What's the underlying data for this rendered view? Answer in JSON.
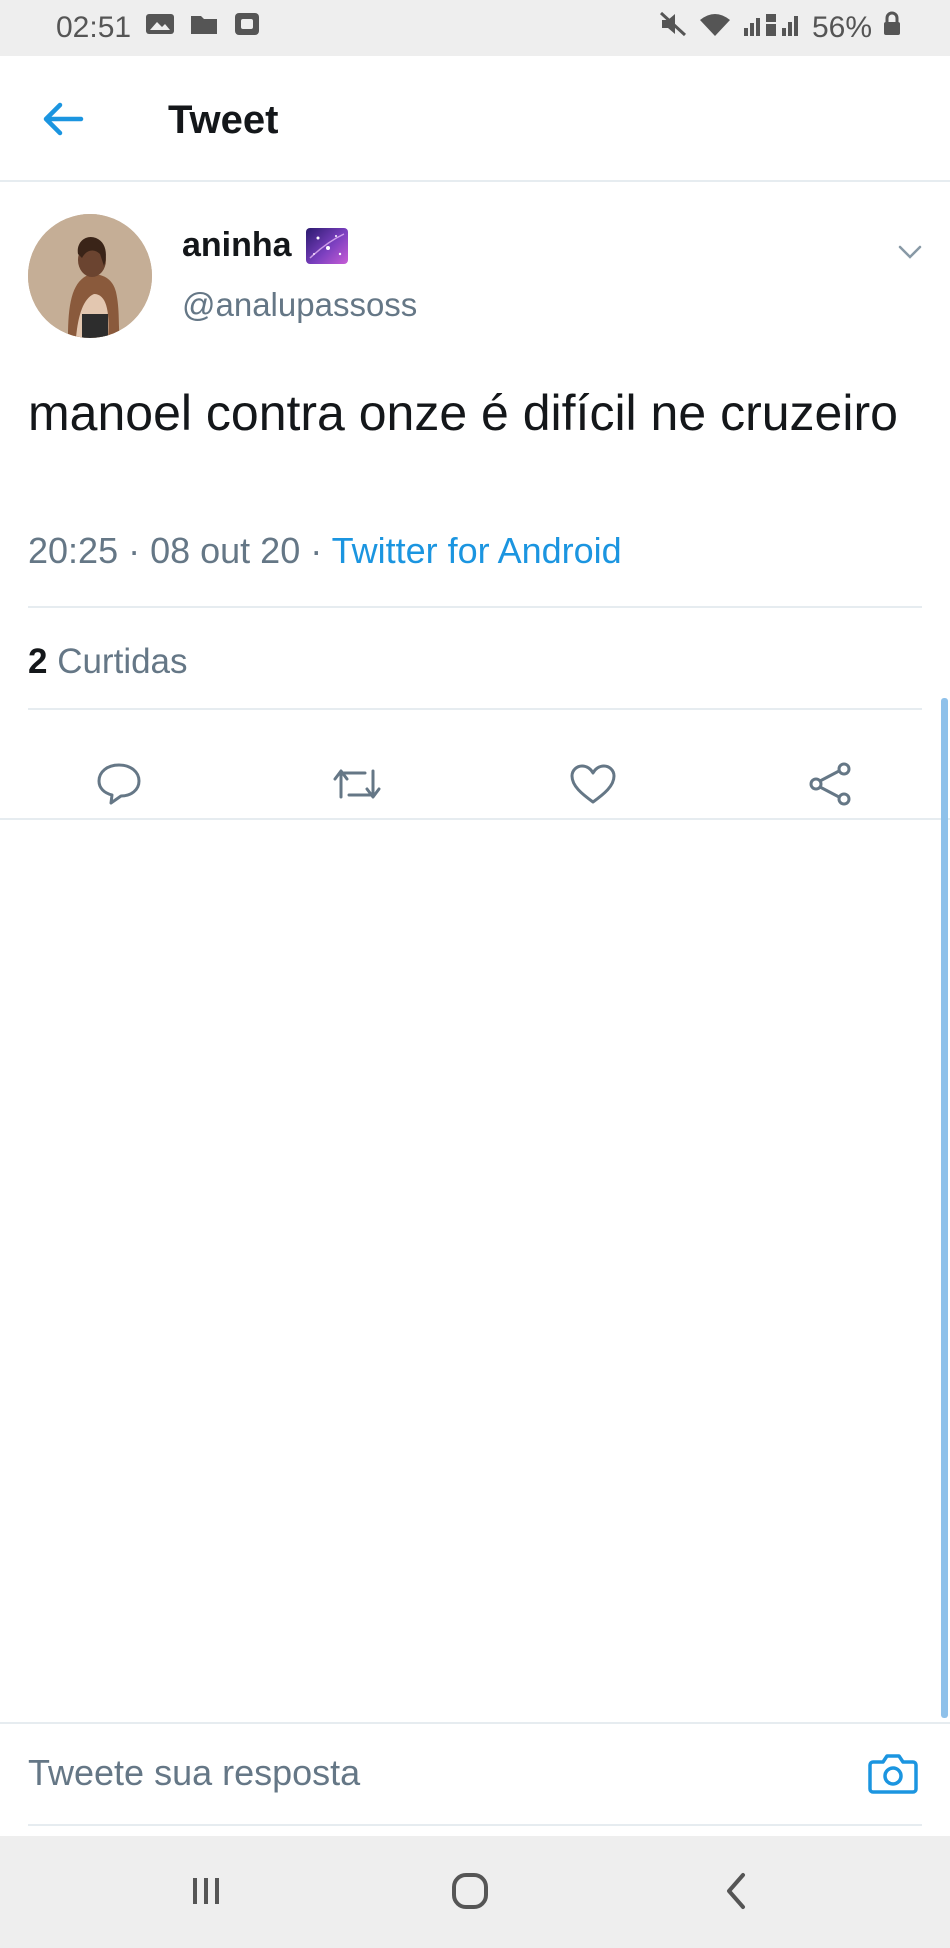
{
  "status_bar": {
    "time": "02:51",
    "battery": "56%",
    "icons": [
      "image-icon",
      "folder-icon",
      "app-notification-icon",
      "mute-icon",
      "wifi-icon",
      "signal-icon",
      "lock-icon"
    ]
  },
  "header": {
    "back_icon": "arrow-left-icon",
    "title": "Tweet"
  },
  "tweet": {
    "display_name": "aninha",
    "emoji": "galaxy-emoji",
    "handle": "@analupassoss",
    "text": "manoel contra onze é difícil ne cruzeiro",
    "timestamp": "20:25 · 08 out 20 · ",
    "source": "Twitter for Android",
    "likes_count": "2",
    "likes_label": " Curtidas"
  },
  "actions": [
    {
      "name": "reply",
      "icon": "reply-bubble-icon"
    },
    {
      "name": "retweet",
      "icon": "retweet-icon"
    },
    {
      "name": "like",
      "icon": "heart-icon"
    },
    {
      "name": "share",
      "icon": "share-icon"
    }
  ],
  "reply_bar": {
    "placeholder": "Tweete sua resposta",
    "camera_icon": "camera-icon"
  },
  "nav_bar": {
    "buttons": [
      "recent-apps-icon",
      "home-icon",
      "back-icon"
    ]
  },
  "colors": {
    "accent": "#1b95e0",
    "secondary_text": "#657786",
    "primary_text": "#14171a",
    "divider": "#e6ecf0",
    "system_bar": "#eeeeee"
  }
}
